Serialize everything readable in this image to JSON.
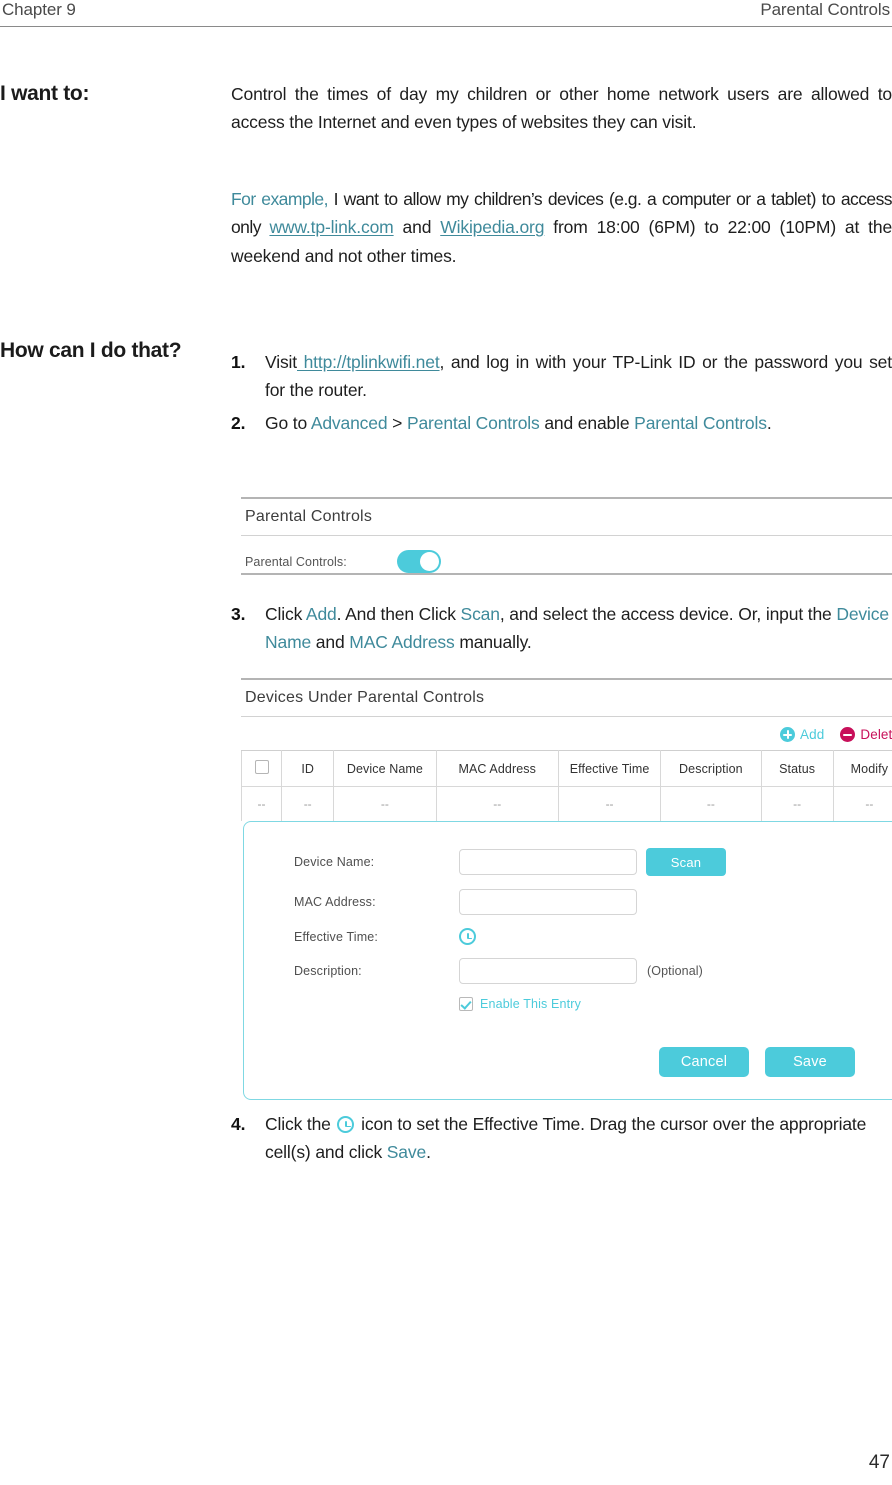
{
  "header": {
    "chapter": "Chapter 9",
    "section": "Parental Controls"
  },
  "sidebar": {
    "want_label": "I want to:",
    "how_label": "How can I do that?"
  },
  "intro": {
    "paragraph": "Control the times of day my children or other home network users are allowed to access the Internet and even types of websites they can visit.",
    "example_prefix": "For example,",
    "example_part1": "I want to allow my children’s devices (e.g. a computer or a tablet) to access only",
    "example_link1": "www.tp-link.com",
    "example_joiner": "and",
    "example_link2": "Wikipedia.org",
    "example_part2": "from 18:00 (6PM) to 22:00 (10PM) at the weekend and not other times."
  },
  "steps": [
    {
      "number": "1.",
      "pre": "Visit",
      "link": " http://tplinkwifi.net",
      "post": ", and log in with your TP-Link ID or the password you set for the router."
    },
    {
      "number": "2.",
      "pre": "Go to ",
      "term1": "Advanced",
      "sep": " > ",
      "term2": "Parental Controls",
      "mid": " and enable ",
      "term3": "Parental Controls",
      "post": "."
    },
    {
      "number": "3.",
      "pre": "Click ",
      "term1": "Add",
      "mid1": ". And then Click ",
      "term2": "Scan",
      "mid2": ", and select the access device. Or, input the ",
      "term3": "Device Name",
      "mid3": " and ",
      "term4": "MAC Address",
      "post": " manually."
    },
    {
      "number": "4.",
      "pre": "Click the ",
      "mid": " icon to set the Effective Time. Drag the cursor over the appropriate cell(s) and click ",
      "term1": "Save",
      "post": "."
    }
  ],
  "parental_panel": {
    "title": "Parental Controls",
    "toggle_label": "Parental Controls:",
    "toggle_state": "on"
  },
  "devices_panel": {
    "title": "Devices Under Parental Controls",
    "add_label": "Add",
    "delete_label": "Delete",
    "table": {
      "columns": [
        "",
        "ID",
        "Device Name",
        "MAC Address",
        "Effective Time",
        "Description",
        "Status",
        "Modify"
      ],
      "rows": [
        [
          "--",
          "--",
          "--",
          "--",
          "--",
          "--",
          "--",
          "--"
        ]
      ]
    },
    "form": {
      "device_name_label": "Device Name:",
      "device_name_value": "",
      "mac_address_label": "MAC Address:",
      "mac_address_value": "",
      "effective_time_label": "Effective Time:",
      "description_label": "Description:",
      "description_value": "",
      "optional_note": "(Optional)",
      "scan_label": "Scan",
      "enable_label": "Enable This Entry",
      "enable_checked": "true",
      "cancel_label": "Cancel",
      "save_label": "Save"
    }
  },
  "footer": {
    "page_number": "47"
  },
  "colors": {
    "accent_teal": "#3f8a9b",
    "ui_cyan": "#4ccbdb",
    "delete_crimson": "#c8105a",
    "text": "#1e1e1e"
  }
}
